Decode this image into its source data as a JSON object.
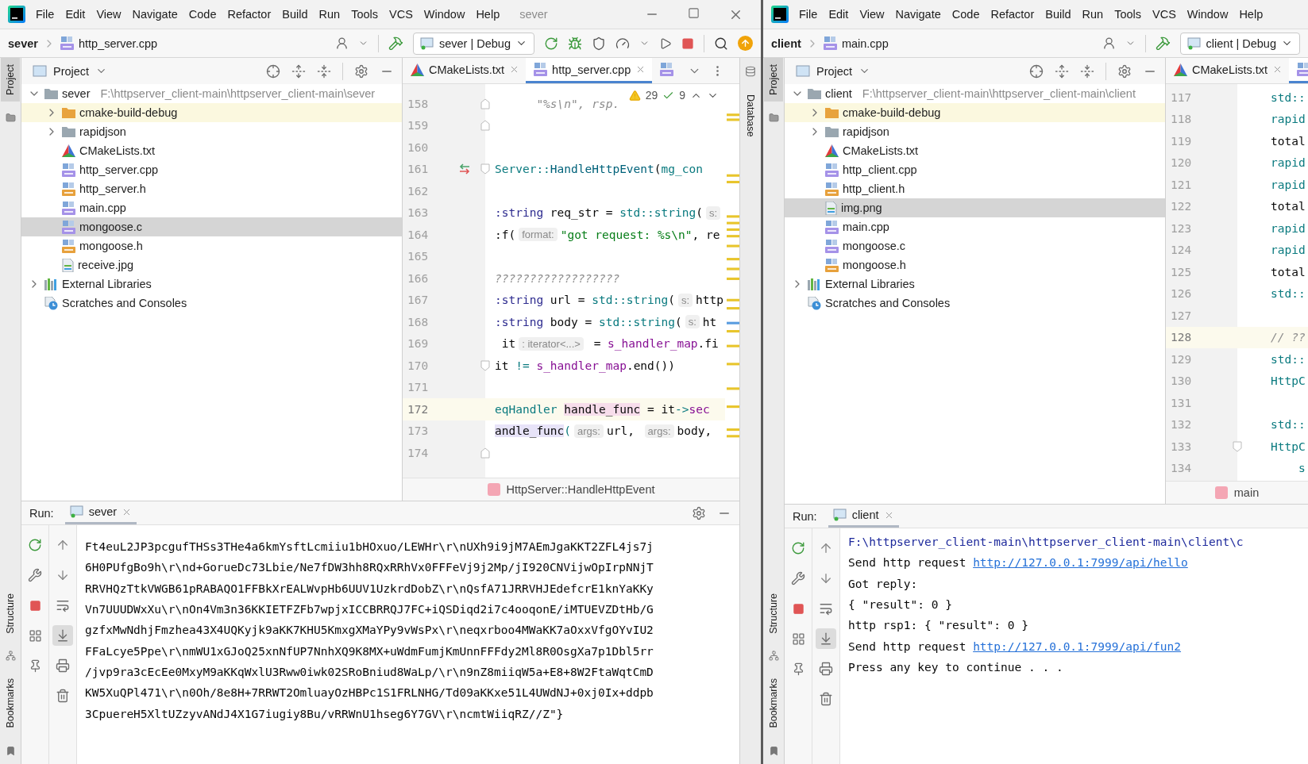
{
  "windows": [
    {
      "menu": [
        "File",
        "Edit",
        "View",
        "Navigate",
        "Code",
        "Refactor",
        "Build",
        "Run",
        "Tools",
        "VCS",
        "Window",
        "Help"
      ],
      "title": "sever",
      "nav": {
        "project": "sever",
        "file": "http_server.cpp",
        "run_config": "sever | Debug"
      },
      "tool_windows": {
        "left_top": [
          {
            "label": "Project",
            "selected": true
          }
        ],
        "left_bottom": [
          "Structure",
          "Bookmarks"
        ],
        "right": [
          "Database"
        ]
      },
      "project_panel": {
        "title": "Project",
        "tree": [
          {
            "label": "sever",
            "path": "F:\\httpserver_client-main\\httpserver_client-main\\sever",
            "kind": "folder",
            "expanded": true,
            "selected": false,
            "excluded": false,
            "children": [
              {
                "label": "cmake-build-debug",
                "kind": "folder_orange",
                "expanded": false,
                "selected": false,
                "excluded": true
              },
              {
                "label": "rapidjson",
                "kind": "folder",
                "expanded": false,
                "selected": false,
                "excluded": false
              },
              {
                "label": "CMakeLists.txt",
                "kind": "cmake",
                "selected": false,
                "excluded": false
              },
              {
                "label": "http_server.cpp",
                "kind": "cpp",
                "selected": false,
                "excluded": false
              },
              {
                "label": "http_server.h",
                "kind": "h",
                "selected": false,
                "excluded": false
              },
              {
                "label": "main.cpp",
                "kind": "cpp",
                "selected": false,
                "excluded": false
              },
              {
                "label": "mongoose.c",
                "kind": "c",
                "selected": true,
                "excluded": false
              },
              {
                "label": "mongoose.h",
                "kind": "h",
                "selected": false,
                "excluded": false
              },
              {
                "label": "receive.jpg",
                "kind": "image",
                "selected": false,
                "excluded": false
              }
            ]
          },
          {
            "label": "External Libraries",
            "kind": "libraries",
            "expanded": false,
            "selected": false,
            "excluded": false
          },
          {
            "label": "Scratches and Consoles",
            "kind": "scratches",
            "selected": false,
            "excluded": false
          }
        ]
      },
      "editor": {
        "tabs": [
          {
            "label": "CMakeLists.txt",
            "kind": "cmake",
            "selected": false
          },
          {
            "label": "http_server.cpp",
            "kind": "cpp",
            "selected": true
          },
          {
            "kind": "cpp",
            "selected": false
          }
        ],
        "inspections": {
          "warnings": "29",
          "checks": "9"
        },
        "lines": [
          {
            "number": "158",
            "current": false,
            "gutter": [
              {
                "kind": "fold_end"
              }
            ],
            "tokens": [
              {
                "kind": "comment",
                "text": "      \"%s\\n\", rsp."
              }
            ]
          },
          {
            "number": "159",
            "current": false,
            "gutter": [
              {
                "kind": "fold_end"
              }
            ]
          },
          {
            "number": "160",
            "current": false
          },
          {
            "number": "161",
            "current": false,
            "gutter": [
              {
                "kind": "override"
              },
              {
                "kind": "fold_start"
              }
            ],
            "tokens": [
              {
                "kind": "type",
                "text": "Server::"
              },
              {
                "kind": "function",
                "text": "HandleHttpEvent"
              },
              {
                "kind": "plain",
                "text": "("
              },
              {
                "kind": "type",
                "text": "mg_con"
              }
            ]
          },
          {
            "number": "162",
            "current": false
          },
          {
            "number": "163",
            "current": false,
            "tokens": [
              {
                "kind": "keyword",
                "text": ":string"
              },
              {
                "kind": "plain",
                "text": " req_str = "
              },
              {
                "kind": "type",
                "text": "std::string"
              },
              {
                "kind": "plain",
                "text": "("
              },
              {
                "kind": "hint",
                "text": "s:"
              }
            ]
          },
          {
            "number": "164",
            "current": false,
            "tokens": [
              {
                "kind": "plain",
                "text": ":f("
              },
              {
                "kind": "hint",
                "text": "format:"
              },
              {
                "kind": "string",
                "text": "\"got request: %s\\n\""
              },
              {
                "kind": "plain",
                "text": ", re"
              }
            ]
          },
          {
            "number": "165",
            "current": false
          },
          {
            "number": "166",
            "current": false,
            "tokens": [
              {
                "kind": "comment",
                "text": "??????????????????"
              }
            ]
          },
          {
            "number": "167",
            "current": false,
            "tokens": [
              {
                "kind": "keyword",
                "text": ":string"
              },
              {
                "kind": "plain",
                "text": " url = "
              },
              {
                "kind": "type",
                "text": "std::string"
              },
              {
                "kind": "plain",
                "text": "("
              },
              {
                "kind": "hint",
                "text": "s:"
              },
              {
                "kind": "plain",
                "text": "http"
              }
            ]
          },
          {
            "number": "168",
            "current": false,
            "tokens": [
              {
                "kind": "keyword",
                "text": ":string"
              },
              {
                "kind": "plain",
                "text": " body = "
              },
              {
                "kind": "type",
                "text": "std::string"
              },
              {
                "kind": "plain",
                "text": "("
              },
              {
                "kind": "hint",
                "text": "s:"
              },
              {
                "kind": "plain",
                "text": "ht"
              }
            ]
          },
          {
            "number": "169",
            "current": false,
            "tokens": [
              {
                "kind": "plain",
                "text": " it"
              },
              {
                "kind": "hint",
                "text": ": iterator<...>"
              },
              {
                "kind": "plain",
                "text": " = "
              },
              {
                "kind": "field",
                "text": "s_handler_map"
              },
              {
                "kind": "plain",
                "text": ".fi"
              }
            ]
          },
          {
            "number": "170",
            "current": false,
            "gutter": [
              {
                "kind": "fold_start"
              }
            ],
            "tokens": [
              {
                "kind": "plain",
                "text": "it "
              },
              {
                "kind": "operator",
                "text": "!= "
              },
              {
                "kind": "field",
                "text": "s_handler_map"
              },
              {
                "kind": "plain",
                "text": ".end())"
              }
            ]
          },
          {
            "number": "171",
            "current": false
          },
          {
            "number": "172",
            "current": true,
            "tokens": [
              {
                "kind": "type",
                "text": "eqHandler "
              },
              {
                "kind": "local_write",
                "text": "handle_func"
              },
              {
                "kind": "plain",
                "text": " = it"
              },
              {
                "kind": "operator",
                "text": "->"
              },
              {
                "kind": "field",
                "text": "sec"
              }
            ]
          },
          {
            "number": "173",
            "current": false,
            "tokens": [
              {
                "kind": "local_read",
                "text": "andle_func"
              },
              {
                "kind": "operator",
                "text": "("
              },
              {
                "kind": "hint",
                "text": "args:"
              },
              {
                "kind": "plain",
                "text": "url, "
              },
              {
                "kind": "hint",
                "text": "args:"
              },
              {
                "kind": "plain",
                "text": "body,"
              }
            ]
          },
          {
            "number": "174",
            "current": false,
            "gutter": [
              {
                "kind": "fold_end"
              }
            ]
          }
        ],
        "breadcrumb": "HttpServer::HandleHttpEvent"
      },
      "run": {
        "label": "Run:",
        "tab": "sever",
        "output": [
          {
            "segments": [
              {
                "kind": "plain",
                "text": "Ft4euL2JP3pcgufTHSs3THe4a6kmYsftLcmiiu1bHOxuo/LEWHr\\r\\nUXh9i9jM7AEmJgaKKT2ZFL4js7j"
              }
            ]
          },
          {
            "segments": [
              {
                "kind": "plain",
                "text": "6H0PUfgBo9h\\r\\nd+GorueDc73Lbie/Ne7fDW3hh8RQxRRhVx0FFFeVj9j2Mp/jI920CNVijwOpIrpNNjT"
              }
            ]
          },
          {
            "segments": [
              {
                "kind": "plain",
                "text": "RRVHQzTtkVWGB61pRABAQO1FFBkXrEALWvpHb6UUV1UzkrdDobZ\\r\\nQsfA71JRRVHJEdefcrE1knYaKKy"
              }
            ]
          },
          {
            "segments": [
              {
                "kind": "plain",
                "text": "Vn7UUUDWxXu\\r\\nOn4Vm3n36KKIETFZFb7wpjxICCBRRQJ7FC+iQSDiqd2i7c4ooqonE/iMTUEVZDtHb/G"
              }
            ]
          },
          {
            "segments": [
              {
                "kind": "plain",
                "text": "gzfxMwNdhjFmzhea43X4UQKyjk9aKK7KHU5KmxgXMaYPy9vWsPx\\r\\neqxrboo4MWaKK7aOxxVfgOYvIU2"
              }
            ]
          },
          {
            "segments": [
              {
                "kind": "plain",
                "text": "FFaLcye5Ppe\\r\\nmWU1xGJoQ25xnNfUP7NnhXQ9K8MX+uWdmFumjKmUnnFFFdy2Ml8R0OsgXa7p1Dbl5rr"
              }
            ]
          },
          {
            "segments": [
              {
                "kind": "plain",
                "text": "/jvp9ra3cEcEe0MxyM9aKKqWxlU3Rww0iwk02SRoBniud8WaLp/\\r\\n9nZ8miiqW5a+E8+8W2FtaWqtCmD"
              }
            ]
          },
          {
            "segments": [
              {
                "kind": "plain",
                "text": "KW5XuQPl471\\r\\n0Oh/8e8H+7RRWT2OmluayOzHBPc1S1FRLNHG/Td09aKKxe51L4UWdNJ+0xj0Ix+ddpb"
              }
            ]
          },
          {
            "segments": [
              {
                "kind": "plain",
                "text": "3CpuereH5XltUZzyvANdJ4X1G7iugiy8Bu/vRRWnU1hseg6Y7GV\\r\\ncmtWiiqRZ//Z\"}"
              }
            ]
          }
        ]
      }
    },
    {
      "menu": [
        "File",
        "Edit",
        "View",
        "Navigate",
        "Code",
        "Refactor",
        "Build",
        "Run",
        "Tools",
        "VCS",
        "Window",
        "Help"
      ],
      "nav": {
        "project": "client",
        "file": "main.cpp",
        "run_config": "client | Debug"
      },
      "tool_windows": {
        "left_top": [
          {
            "label": "Project",
            "selected": true
          }
        ],
        "left_bottom": [
          "Structure",
          "Bookmarks"
        ]
      },
      "project_panel": {
        "title": "Project",
        "tree": [
          {
            "label": "client",
            "path": "F:\\httpserver_client-main\\httpserver_client-main\\client",
            "kind": "folder",
            "expanded": true,
            "selected": false,
            "excluded": false,
            "children": [
              {
                "label": "cmake-build-debug",
                "kind": "folder_orange",
                "expanded": false,
                "selected": false,
                "excluded": true
              },
              {
                "label": "rapidjson",
                "kind": "folder",
                "expanded": false,
                "selected": false,
                "excluded": false
              },
              {
                "label": "CMakeLists.txt",
                "kind": "cmake",
                "selected": false,
                "excluded": false
              },
              {
                "label": "http_client.cpp",
                "kind": "cpp",
                "selected": false,
                "excluded": false
              },
              {
                "label": "http_client.h",
                "kind": "h",
                "selected": false,
                "excluded": false
              },
              {
                "label": "img.png",
                "kind": "image",
                "selected": true,
                "excluded": false
              },
              {
                "label": "main.cpp",
                "kind": "cpp",
                "selected": false,
                "excluded": false
              },
              {
                "label": "mongoose.c",
                "kind": "c",
                "selected": false,
                "excluded": false
              },
              {
                "label": "mongoose.h",
                "kind": "h",
                "selected": false,
                "excluded": false
              }
            ]
          },
          {
            "label": "External Libraries",
            "kind": "libraries",
            "expanded": false,
            "selected": false,
            "excluded": false
          },
          {
            "label": "Scratches and Consoles",
            "kind": "scratches",
            "selected": false,
            "excluded": false
          }
        ]
      },
      "editor": {
        "tabs": [
          {
            "label": "CMakeLists.txt",
            "kind": "cmake",
            "selected": false
          },
          {
            "kind": "cpp",
            "selected": true
          }
        ],
        "lines": [
          {
            "number": "117",
            "current": false,
            "tokens": [
              {
                "kind": "type",
                "text": "std::"
              }
            ]
          },
          {
            "number": "118",
            "current": false,
            "tokens": [
              {
                "kind": "type",
                "text": "rapid"
              }
            ]
          },
          {
            "number": "119",
            "current": false,
            "tokens": [
              {
                "kind": "plain",
                "text": "total"
              }
            ]
          },
          {
            "number": "120",
            "current": false,
            "tokens": [
              {
                "kind": "type",
                "text": "rapid"
              }
            ]
          },
          {
            "number": "121",
            "current": false,
            "tokens": [
              {
                "kind": "type",
                "text": "rapid"
              }
            ]
          },
          {
            "number": "122",
            "current": false,
            "tokens": [
              {
                "kind": "plain",
                "text": "total"
              }
            ]
          },
          {
            "number": "123",
            "current": false,
            "tokens": [
              {
                "kind": "type",
                "text": "rapid"
              }
            ]
          },
          {
            "number": "124",
            "current": false,
            "tokens": [
              {
                "kind": "type",
                "text": "rapid"
              }
            ]
          },
          {
            "number": "125",
            "current": false,
            "tokens": [
              {
                "kind": "plain",
                "text": "total"
              }
            ]
          },
          {
            "number": "126",
            "current": false,
            "tokens": [
              {
                "kind": "type",
                "text": "std::"
              }
            ]
          },
          {
            "number": "127",
            "current": false
          },
          {
            "number": "128",
            "current": true,
            "tokens": [
              {
                "kind": "comment",
                "text": "// ??"
              }
            ]
          },
          {
            "number": "129",
            "current": false,
            "tokens": [
              {
                "kind": "type",
                "text": "std::"
              }
            ]
          },
          {
            "number": "130",
            "current": false,
            "tokens": [
              {
                "kind": "type",
                "text": "HttpC"
              }
            ]
          },
          {
            "number": "131",
            "current": false
          },
          {
            "number": "132",
            "current": false,
            "tokens": [
              {
                "kind": "type",
                "text": "std::"
              }
            ]
          },
          {
            "number": "133",
            "current": false,
            "gutter": [
              {
                "kind": "fold_start"
              }
            ],
            "tokens": [
              {
                "kind": "type",
                "text": "HttpC"
              }
            ]
          },
          {
            "number": "134",
            "current": false,
            "tokens": [
              {
                "kind": "type",
                "text": "    s"
              }
            ]
          }
        ],
        "breadcrumb": "main"
      },
      "run": {
        "label": "Run:",
        "tab": "client",
        "output": [
          {
            "segments": [
              {
                "kind": "path",
                "text": "F:\\httpserver_client-main\\httpserver_client-main\\client\\c"
              }
            ]
          },
          {
            "segments": [
              {
                "kind": "plain",
                "text": "Send http request "
              },
              {
                "kind": "link",
                "text": "http://127.0.0.1:7999/api/hello"
              }
            ]
          },
          {
            "segments": [
              {
                "kind": "plain",
                "text": "Got reply:"
              }
            ]
          },
          {
            "segments": [
              {
                "kind": "plain",
                "text": "{ \"result\": 0 }"
              }
            ]
          },
          {
            "segments": [
              {
                "kind": "plain",
                "text": "http rsp1: { \"result\": 0 }"
              }
            ]
          },
          {
            "segments": [
              {
                "kind": "plain",
                "text": "Send http request "
              },
              {
                "kind": "link",
                "text": "http://127.0.0.1:7999/api/fun2"
              }
            ]
          },
          {
            "segments": [
              {
                "kind": "plain",
                "text": "Press any key to continue . . ."
              }
            ]
          }
        ]
      }
    }
  ]
}
